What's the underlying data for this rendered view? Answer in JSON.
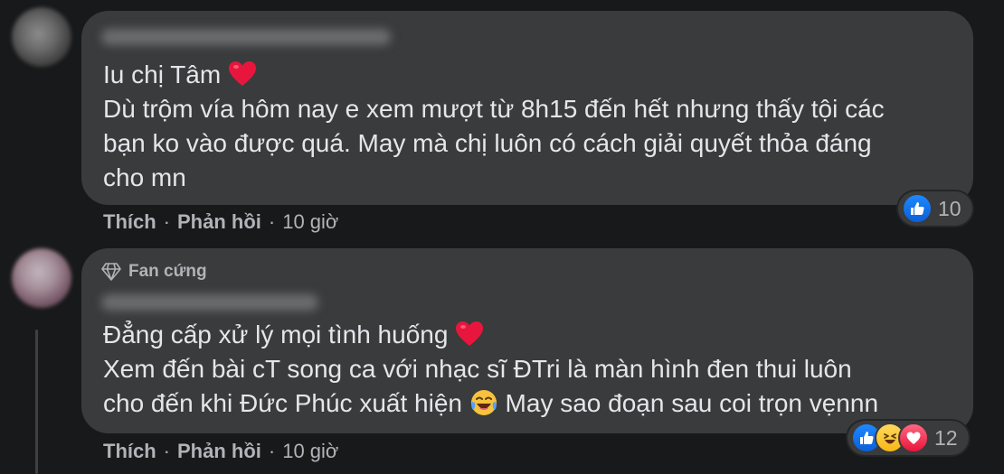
{
  "comments": [
    {
      "author": "Trương Bảo Trân Nguyễn",
      "badge": "",
      "lines": [
        "Iu chị Tâm",
        "Dù trộm vía hôm nay e xem mượt từ 8h15 đến hết nhưng thấy tội các",
        "bạn ko vào được quá. May mà chị luôn có cách giải quyết thỏa đáng",
        "cho mn"
      ],
      "actions": {
        "like": "Thích",
        "reply": "Phản hồi",
        "sep": "·",
        "time": "10 giờ"
      },
      "reactions": {
        "icons": [
          "like-icon"
        ],
        "count": "10"
      }
    },
    {
      "author": "Phương Bi Nguyễn",
      "badge": "Fan cứng",
      "lines": [
        "Đẳng cấp xử lý mọi tình huống",
        "Xem đến bài cT song ca với nhạc sĩ ĐTri là màn hình đen thui luôn",
        "cho đến khi Đức Phúc xuất hiện",
        "May sao đoạn sau coi trọn vẹnnn"
      ],
      "actions": {
        "like": "Thích",
        "reply": "Phản hồi",
        "sep": "·",
        "time": "10 giờ"
      },
      "reactions": {
        "icons": [
          "like-icon",
          "haha-icon",
          "love-icon"
        ],
        "count": "12"
      }
    }
  ],
  "colors": {
    "background": "#18191a",
    "bubble": "#3a3b3c",
    "text": "#e4e6eb",
    "secondary_text": "#b0b3b8",
    "like_blue": "#1877f2",
    "heart_red": "#e8163c"
  }
}
